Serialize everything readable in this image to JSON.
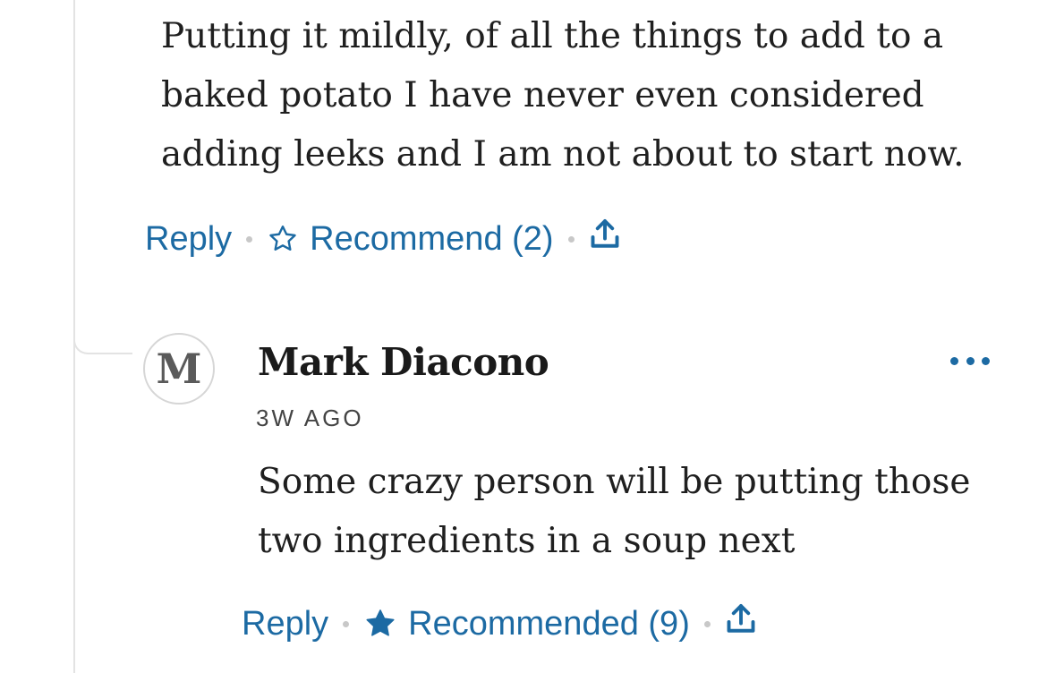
{
  "parent_comment": {
    "body": "Putting it mildly, of all the things to add to a baked potato I have never even considered adding leeks and I am not about to start now.",
    "actions": {
      "reply_label": "Reply",
      "recommend_label": "Recommend (2)",
      "recommend_icon": "star-outline-icon",
      "share_icon": "share-icon"
    }
  },
  "reply_comment": {
    "avatar_initial": "M",
    "author": "Mark Diacono",
    "timestamp": "3W AGO",
    "body": "Some crazy person will be putting those two ingredients in a soup next",
    "more_icon": "more-options-icon",
    "actions": {
      "reply_label": "Reply",
      "recommend_label": "Recommended (9)",
      "recommend_icon": "star-filled-icon",
      "share_icon": "share-icon"
    }
  },
  "colors": {
    "link": "#1c6aa3",
    "thread_line": "#e3e3e3",
    "text": "#1f1f1f"
  }
}
